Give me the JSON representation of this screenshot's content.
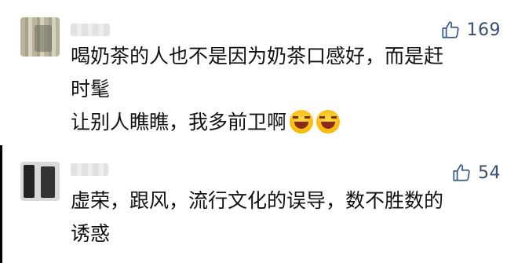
{
  "comments": [
    {
      "likes": "169",
      "lines": [
        "喝奶茶的人也不是因为奶茶口感好，而是赶",
        "时髦",
        "让别人瞧瞧，我多前卫啊"
      ],
      "emoji_icons": [
        "laughing-crying-emoji",
        "laughing-crying-emoji"
      ]
    },
    {
      "likes": "54",
      "lines": [
        "虚荣，跟风，流行文化的误导，数不胜数的",
        "诱惑"
      ]
    }
  ],
  "icons": {
    "like": "thumbs-up-icon"
  },
  "colors": {
    "like": "#3a5a8c",
    "text": "#111111"
  }
}
